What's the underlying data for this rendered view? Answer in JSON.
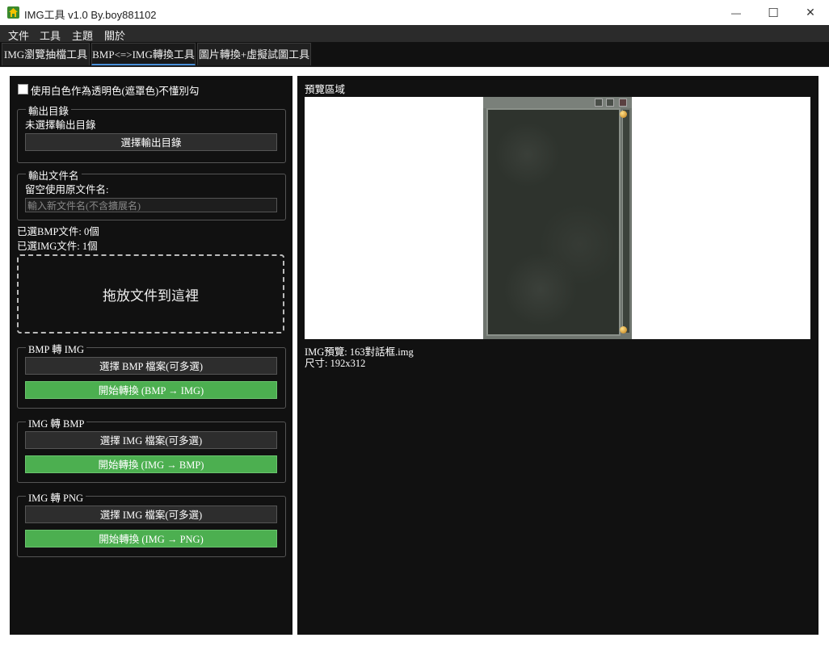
{
  "window": {
    "title": "IMG工具 v1.0 By.boy881102",
    "minimize_glyph": "—",
    "maximize_glyph": "☐",
    "close_glyph": "✕"
  },
  "menu": {
    "items": [
      "文件",
      "工具",
      "主題",
      "關於"
    ]
  },
  "tabs": [
    {
      "label": "IMG瀏覽抽檔工具",
      "active": false
    },
    {
      "label": "BMP<=>IMG轉換工具",
      "active": true
    },
    {
      "label": "圖片轉換+虛擬試圖工具",
      "active": false
    }
  ],
  "left": {
    "transparent_checkbox": {
      "label": "使用白色作為透明色(遮罩色)不懂別勾",
      "checked": false
    },
    "output_dir": {
      "legend": "輸出目錄",
      "status": "未選擇輸出目錄",
      "button": "選擇輸出目錄"
    },
    "output_name": {
      "legend": "輸出文件名",
      "hint": "留空使用原文件名:",
      "placeholder": "輸入新文件名(不含擴展名)"
    },
    "selected_bmp": "已選BMP文件: 0個",
    "selected_img": "已選IMG文件: 1個",
    "dropzone": "拖放文件到這裡",
    "bmp_to_img": {
      "legend": "BMP 轉 IMG",
      "select_button": "選擇 BMP 檔案(可多選)",
      "start_button": "開始轉換 (BMP → IMG)"
    },
    "img_to_bmp": {
      "legend": "IMG 轉 BMP",
      "select_button": "選擇 IMG 檔案(可多選)",
      "start_button": "開始轉換 (IMG → BMP)"
    },
    "img_to_png": {
      "legend": "IMG 轉 PNG",
      "select_button": "選擇 IMG 檔案(可多選)",
      "start_button": "開始轉換 (IMG → PNG)"
    }
  },
  "right": {
    "title": "預覽區域",
    "preview_name": "IMG預覽: 163對話框.img",
    "preview_size": "尺寸: 192x312"
  },
  "colors": {
    "accent_green": "#4caf50",
    "panel_bg": "#111111",
    "active_tab_underline": "#4a90d9"
  }
}
